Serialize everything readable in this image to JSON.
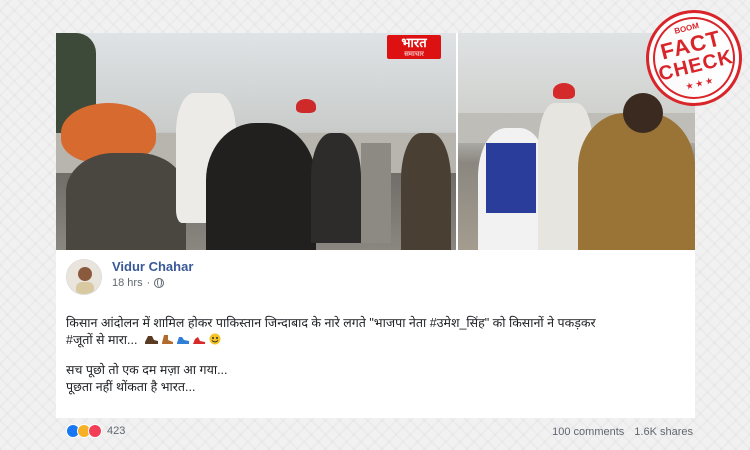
{
  "video": {
    "channel_logo_main": "भारत",
    "channel_logo_sub": "समाचार",
    "stamp_top": "BOOM",
    "stamp_line1": "FACT",
    "stamp_line2": "CHECK",
    "stamp_stars": "★★★"
  },
  "post": {
    "author": "Vidur Chahar",
    "time": "18 hrs",
    "dot": "·",
    "line1": "किसान आंदोलन में शामिल होकर पाकिस्तान जिन्दाबाद के नारे लगते \"भाजपा नेता #उमेश_सिंह\" को किसानों ने पकड़कर",
    "line2": "#जूतों से मारा...",
    "line3": "सच पूछो तो एक दम मज़ा आ गया...",
    "line4": "पूछता नहीं थोंकता है भारत...",
    "reaction_count": "423",
    "comments": "100 comments",
    "shares": "1.6K shares"
  },
  "colors": {
    "author_link": "#385898",
    "stamp_red": "#d9252a",
    "like_blue": "#1877f2"
  }
}
